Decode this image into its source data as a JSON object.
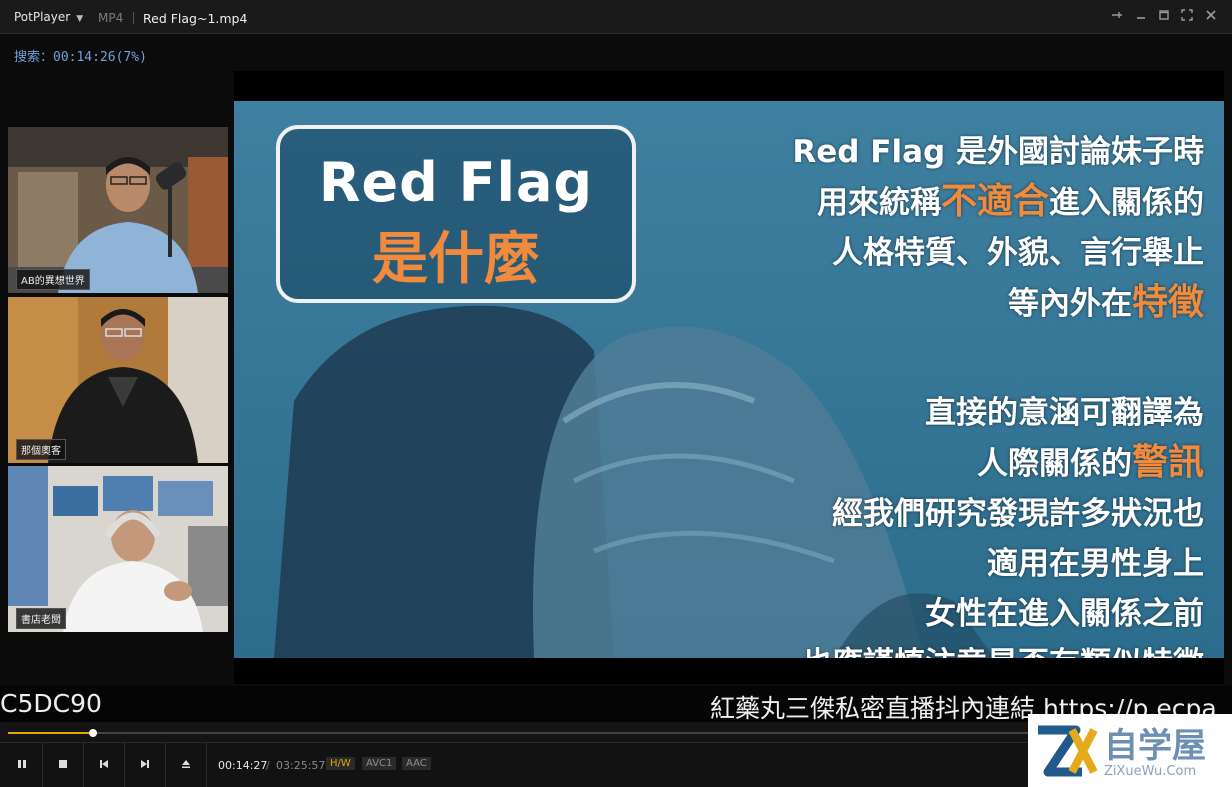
{
  "titlebar": {
    "app_name": "PotPlayer",
    "format": "MP4",
    "file_title": "Red Flag~1.mp4"
  },
  "osd": {
    "seek_text": "搜索：00:14:26(7%)"
  },
  "participants": [
    {
      "label": "AB的異想世界"
    },
    {
      "label": "那個奧客"
    },
    {
      "label": "書店老闆"
    }
  ],
  "slide": {
    "box_en": "Red Flag",
    "box_zh": "是什麼",
    "block1": [
      [
        "Red Flag 是外國討論妹子時",
        ""
      ],
      [
        "用來統稱",
        "不適合",
        "進入關係的"
      ],
      [
        "人格特質、外貌、言行舉止"
      ],
      [
        "等內外在",
        "特徵"
      ]
    ],
    "block1_flat": {
      "l1": "Red Flag 是外國討論妹子時",
      "l2a": "用來統稱",
      "l2b": "不適合",
      "l2c": "進入關係的",
      "l3": "人格特質、外貌、言行舉止",
      "l4a": "等內外在",
      "l4b": "特徵"
    },
    "block2_flat": {
      "l1": "直接的意涵可翻譯為",
      "l2a": "人際關係的",
      "l2b": "警訊",
      "l3": "經我們研究發現許多狀況也",
      "l4": "適用在男性身上",
      "l5": "女性在進入關係之前",
      "l6": "也應謹慎注意是否有類似特徵"
    },
    "highlight_color": "#f08a3c"
  },
  "ticker": {
    "left": "C5DC90",
    "right": "紅藥丸三傑私密直播抖內連結 https://p.ecpa"
  },
  "playback": {
    "progress_percent": 7,
    "time_current": "00:14:27",
    "time_separator": "/",
    "time_total": "03:25:57",
    "tags": [
      "H/W",
      "AVC1",
      "AAC"
    ],
    "accent": "#e0a800"
  },
  "watermark": {
    "logo_letter": "ZX",
    "cn": "自学屋",
    "en": "ZiXueWu.Com"
  }
}
